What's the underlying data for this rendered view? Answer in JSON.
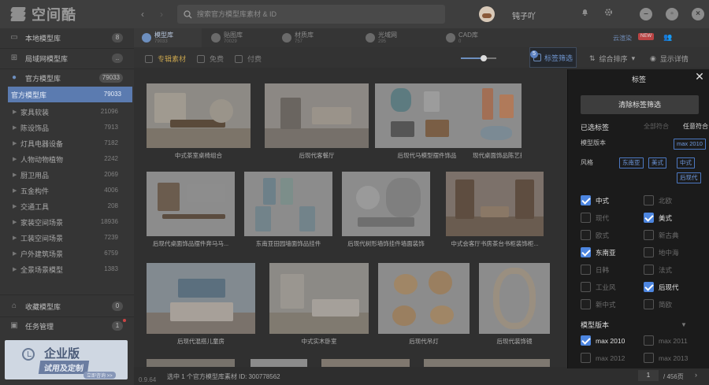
{
  "app": {
    "name": "空间酷",
    "version": "0.9.64"
  },
  "titlebar": {
    "search_placeholder": "搜索官方模型库素材 & ID",
    "user_name": "钝子吖"
  },
  "sidebar": {
    "local_lib": {
      "label": "本地模型库",
      "count": "8"
    },
    "lan_lib": {
      "label": "局域网模型库",
      "count": ".."
    },
    "official_lib": {
      "label": "官方模型库",
      "count": "79033"
    },
    "items": [
      {
        "label": "官方模型库",
        "count": "79033",
        "active": true
      },
      {
        "label": "家具软装",
        "count": "21096"
      },
      {
        "label": "陈设饰品",
        "count": "7913"
      },
      {
        "label": "灯具电器设备",
        "count": "7182"
      },
      {
        "label": "人物动物植物",
        "count": "2242"
      },
      {
        "label": "厨卫用品",
        "count": "2069"
      },
      {
        "label": "五金构件",
        "count": "4006"
      },
      {
        "label": "交通工具",
        "count": "208"
      },
      {
        "label": "家装空间场景",
        "count": "18936"
      },
      {
        "label": "工装空间场景",
        "count": "7239"
      },
      {
        "label": "户外建筑场景",
        "count": "6759"
      },
      {
        "label": "全景场景模型",
        "count": "1383"
      }
    ],
    "favorites": {
      "label": "收藏模型库",
      "count": "0"
    },
    "tasks": {
      "label": "任务管理",
      "count": "1"
    },
    "promo": {
      "title": "企业版",
      "subtitle": "试用及定制",
      "cta": "立即咨询 >>"
    }
  },
  "lib_tabs": [
    {
      "name": "模型库",
      "num": "79033",
      "active": true
    },
    {
      "name": "贴图库",
      "num": "70029"
    },
    {
      "name": "材质库",
      "num": "757"
    },
    {
      "name": "光域网",
      "num": "295"
    },
    {
      "name": "CAD库",
      "num": "0"
    }
  ],
  "cloud": {
    "label": "云渲染",
    "badge": "NEW"
  },
  "filters": {
    "exclusive": "专辑素材",
    "free": "免费",
    "paid": "付费",
    "tag_filter": "标签筛选",
    "tag_filter_count": "5",
    "sort": "综合排序",
    "details": "显示详情"
  },
  "grid": {
    "captions": [
      "中式茶室桌椅组合",
      "后现代客餐厅",
      "后现代马模型摆件饰品",
      "现代桌面饰品陈艺摆件",
      "后现代桌面饰品摆件奔马马...",
      "东南亚田园墙面饰品挂件",
      "后现代树形墙饰挂件墙面装饰",
      "中式会客厅书房茶台书柜装饰柜...",
      "后现代混搭儿童房",
      "中式实木卧室",
      "后现代吊灯",
      "后现代装饰镜"
    ]
  },
  "status": {
    "text": "选中 1 个官方模型库素材 ID: 300778562",
    "page": "1",
    "total": "/ 456页"
  },
  "tag_panel": {
    "title": "标签",
    "clear": "清除标签筛选",
    "selected_label": "已选标签",
    "match_all": "全部符合",
    "match_any": "任意符合",
    "version_label": "模型版本",
    "version_chips": [
      "max 2010"
    ],
    "style_label": "风格",
    "style_chips": [
      "东南亚",
      "美式",
      "中式",
      "后现代"
    ],
    "style_options": [
      {
        "label": "中式",
        "checked": true
      },
      {
        "label": "北欧",
        "checked": false
      },
      {
        "label": "现代",
        "checked": false
      },
      {
        "label": "美式",
        "checked": true
      },
      {
        "label": "欧式",
        "checked": false
      },
      {
        "label": "新古典",
        "checked": false
      },
      {
        "label": "东南亚",
        "checked": true
      },
      {
        "label": "地中海",
        "checked": false
      },
      {
        "label": "日韩",
        "checked": false
      },
      {
        "label": "法式",
        "checked": false
      },
      {
        "label": "工业风",
        "checked": false
      },
      {
        "label": "后现代",
        "checked": true
      },
      {
        "label": "新中式",
        "checked": false
      },
      {
        "label": "简欧",
        "checked": false
      }
    ],
    "version_section": "模型版本",
    "version_options": [
      {
        "label": "max 2010",
        "checked": true
      },
      {
        "label": "max 2011",
        "checked": false
      },
      {
        "label": "max 2012",
        "checked": false
      },
      {
        "label": "max 2013",
        "checked": false
      }
    ]
  }
}
